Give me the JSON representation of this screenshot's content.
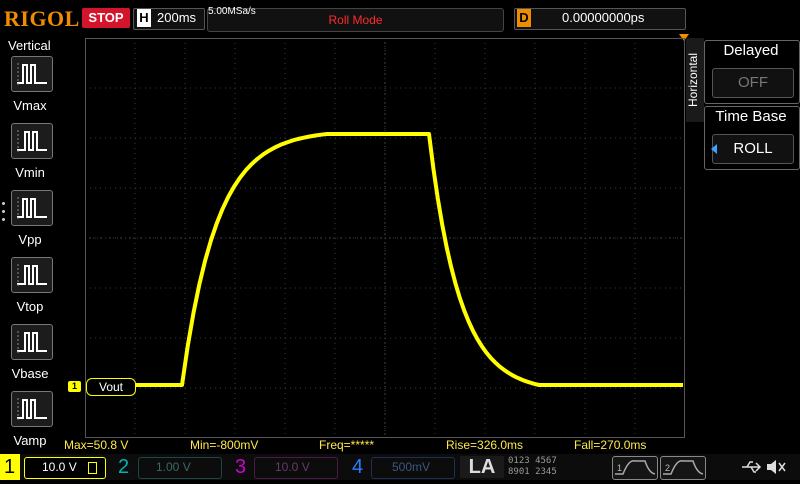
{
  "topbar": {
    "logo": "RIGOL",
    "run_status": "STOP",
    "h_label": "H",
    "timebase": "200ms",
    "sample_rate": "5.00MSa/s",
    "mode": "Roll Mode",
    "d_label": "D",
    "delay": "0.00000000ps"
  },
  "left_menu": {
    "title": "Vertical",
    "items": [
      {
        "label": "Vmax",
        "icon": "vmax-icon"
      },
      {
        "label": "Vmin",
        "icon": "vmin-icon"
      },
      {
        "label": "Vpp",
        "icon": "vpp-icon"
      },
      {
        "label": "Vtop",
        "icon": "vtop-icon"
      },
      {
        "label": "Vbase",
        "icon": "vbase-icon"
      },
      {
        "label": "Vamp",
        "icon": "vamp-icon"
      }
    ]
  },
  "right_menu": {
    "tab": "Horizontal",
    "delayed": {
      "title": "Delayed",
      "value": "OFF"
    },
    "timebase": {
      "title": "Time Base",
      "value": "ROLL"
    }
  },
  "trace": {
    "label": "Vout",
    "channel_marker": "1",
    "color": "#ffff00"
  },
  "measurements": {
    "max": "Max=50.8 V",
    "min": "Min=-800mV",
    "freq": "Freq=*****",
    "rise": "Rise=326.0ms",
    "fall": "Fall=270.0ms"
  },
  "channels": [
    {
      "num": "1",
      "scale": "10.0 V",
      "color": "#ffff00"
    },
    {
      "num": "2",
      "scale": "1.00 V",
      "color": "#00b3b3"
    },
    {
      "num": "3",
      "scale": "10.0 V",
      "color": "#d000d0"
    },
    {
      "num": "4",
      "scale": "500mV",
      "color": "#2a7cff"
    }
  ],
  "la": {
    "label": "LA",
    "row1": "0123 4567",
    "row2": "8901 2345"
  },
  "triggers": [
    {
      "num": "1"
    },
    {
      "num": "2"
    }
  ],
  "colors": {
    "accent": "#f08c00",
    "stop": "#d4142a",
    "grid": "#3a3a3a"
  }
}
